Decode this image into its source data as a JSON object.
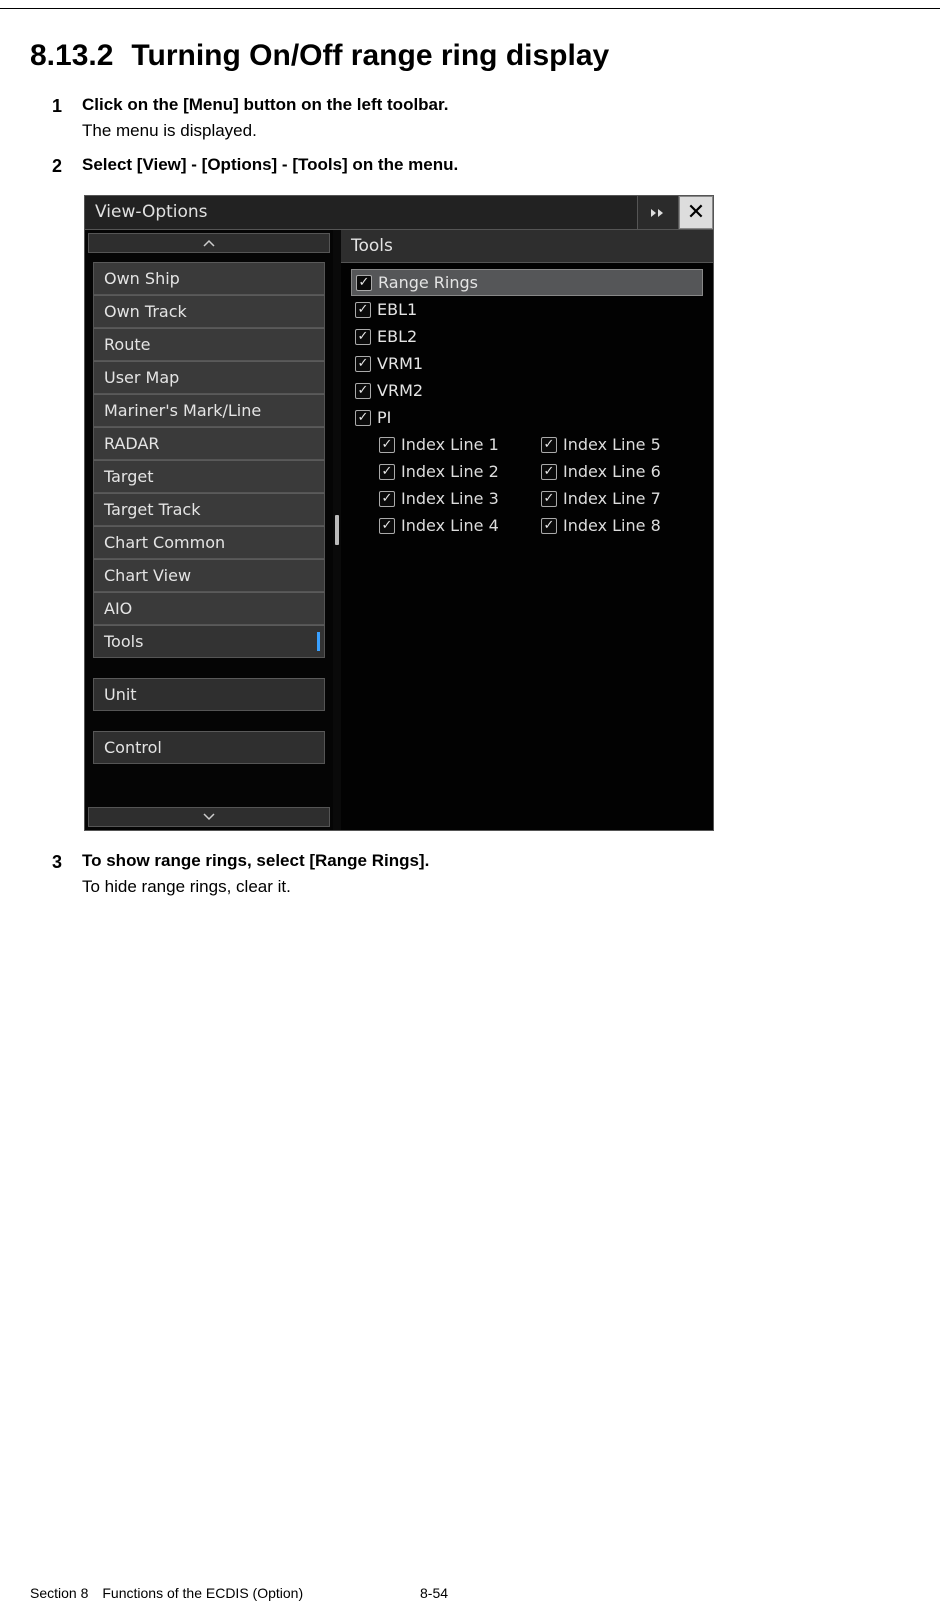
{
  "heading": {
    "number": "8.13.2",
    "title": "Turning On/Off range ring display"
  },
  "steps": [
    {
      "num": "1",
      "title": "Click on the [Menu] button on the left toolbar.",
      "desc": "The menu is displayed."
    },
    {
      "num": "2",
      "title": "Select [View] - [Options] - [Tools] on the menu.",
      "desc": ""
    },
    {
      "num": "3",
      "title": "To show range rings, select [Range Rings].",
      "desc": "To hide range rings, clear it."
    }
  ],
  "dialog": {
    "title": "View-Options",
    "close_glyph": "✕",
    "left_items": [
      "Own Ship",
      "Own Track",
      "Route",
      "User Map",
      "Mariner's Mark/Line",
      "RADAR",
      "Target",
      "Target Track",
      "Chart Common",
      "Chart View",
      "AIO",
      "Tools"
    ],
    "left_extra": [
      "Unit",
      "Control"
    ],
    "right_header": "Tools",
    "checkboxes": [
      {
        "label": "Range Rings",
        "highlight": true
      },
      {
        "label": "EBL1"
      },
      {
        "label": "EBL2"
      },
      {
        "label": "VRM1"
      },
      {
        "label": "VRM2"
      },
      {
        "label": "PI"
      }
    ],
    "index_lines_left": [
      "Index Line 1",
      "Index Line 2",
      "Index Line 3",
      "Index Line 4"
    ],
    "index_lines_right": [
      "Index Line 5",
      "Index Line 6",
      "Index Line 7",
      "Index Line 8"
    ]
  },
  "footer": {
    "section": "Section 8 Functions of the ECDIS (Option)",
    "page": "8-54"
  }
}
